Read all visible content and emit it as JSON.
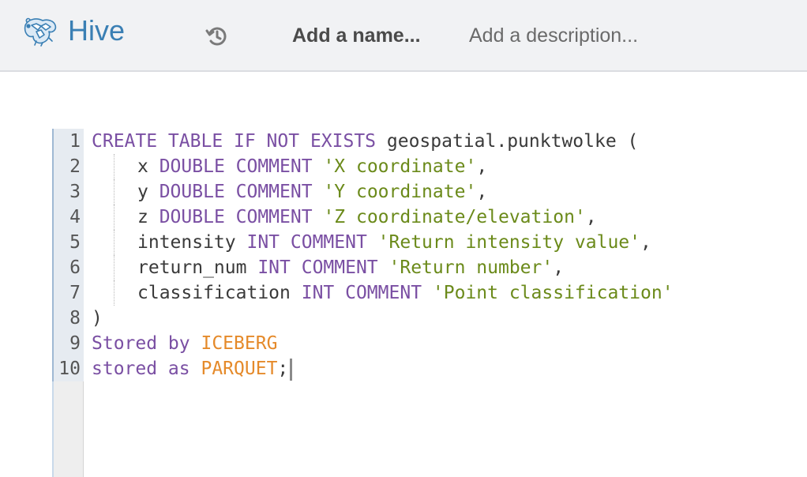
{
  "header": {
    "app_name": "Hive",
    "name_placeholder": "Add a name...",
    "description_placeholder": "Add a description...",
    "history_icon": "history-icon",
    "logo_icon": "hive-bee-logo-icon"
  },
  "editor": {
    "line_numbers": [
      "1",
      "2",
      "3",
      "4",
      "5",
      "6",
      "7",
      "8",
      "9",
      "10"
    ],
    "lines": [
      {
        "tokens": [
          {
            "t": "CREATE TABLE IF NOT EXISTS",
            "k": "kw"
          },
          {
            "t": " geospatial.punktwolke (",
            "k": "id"
          }
        ]
      },
      {
        "indent": true,
        "tokens": [
          {
            "t": "x ",
            "k": "id"
          },
          {
            "t": "DOUBLE COMMENT",
            "k": "kw"
          },
          {
            "t": " ",
            "k": "id"
          },
          {
            "t": "'X coordinate'",
            "k": "str"
          },
          {
            "t": ",",
            "k": "punc"
          }
        ]
      },
      {
        "indent": true,
        "tokens": [
          {
            "t": "y ",
            "k": "id"
          },
          {
            "t": "DOUBLE COMMENT",
            "k": "kw"
          },
          {
            "t": " ",
            "k": "id"
          },
          {
            "t": "'Y coordinate'",
            "k": "str"
          },
          {
            "t": ",",
            "k": "punc"
          }
        ]
      },
      {
        "indent": true,
        "tokens": [
          {
            "t": "z ",
            "k": "id"
          },
          {
            "t": "DOUBLE COMMENT",
            "k": "kw"
          },
          {
            "t": " ",
            "k": "id"
          },
          {
            "t": "'Z coordinate/elevation'",
            "k": "str"
          },
          {
            "t": ",",
            "k": "punc"
          }
        ]
      },
      {
        "indent": true,
        "tokens": [
          {
            "t": "intensity ",
            "k": "id"
          },
          {
            "t": "INT COMMENT",
            "k": "kw"
          },
          {
            "t": " ",
            "k": "id"
          },
          {
            "t": "'Return intensity value'",
            "k": "str"
          },
          {
            "t": ",",
            "k": "punc"
          }
        ]
      },
      {
        "indent": true,
        "tokens": [
          {
            "t": "return_num ",
            "k": "id"
          },
          {
            "t": "INT COMMENT",
            "k": "kw"
          },
          {
            "t": " ",
            "k": "id"
          },
          {
            "t": "'Return number'",
            "k": "str"
          },
          {
            "t": ",",
            "k": "punc"
          }
        ]
      },
      {
        "indent": true,
        "tokens": [
          {
            "t": "classification ",
            "k": "id"
          },
          {
            "t": "INT COMMENT",
            "k": "kw"
          },
          {
            "t": " ",
            "k": "id"
          },
          {
            "t": "'Point classification'",
            "k": "str"
          }
        ]
      },
      {
        "tokens": [
          {
            "t": ")",
            "k": "punc"
          }
        ]
      },
      {
        "tokens": [
          {
            "t": "Stored by",
            "k": "kw"
          },
          {
            "t": " ",
            "k": "id"
          },
          {
            "t": "ICEBERG",
            "k": "const"
          }
        ]
      },
      {
        "tokens": [
          {
            "t": "stored as",
            "k": "kw"
          },
          {
            "t": " ",
            "k": "id"
          },
          {
            "t": "PARQUET",
            "k": "const"
          },
          {
            "t": ";",
            "k": "punc"
          }
        ],
        "cursor": true
      }
    ]
  },
  "colors": {
    "keyword": "#7a4fa3",
    "string": "#6b8a1a",
    "constant": "#e58a2a",
    "brand": "#3a7fb4"
  }
}
